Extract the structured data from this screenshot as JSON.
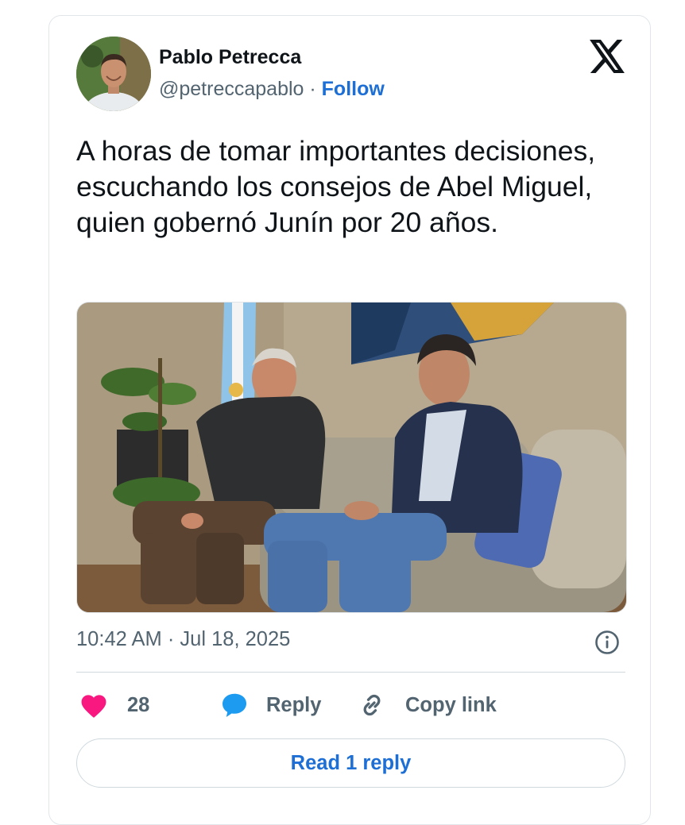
{
  "author": {
    "name": "Pablo Petrecca",
    "handle": "@petreccapablo",
    "separator": " · ",
    "follow_label": "Follow"
  },
  "platform_logo": "x-logo",
  "tweet": {
    "text": "A horas de tomar importantes decisiones, escuchando los consejos de Abel Miguel, quien gobernó Junín por 20 años.",
    "timestamp": "10:42 AM · Jul 18, 2025"
  },
  "actions": {
    "like_count": "28",
    "reply_label": "Reply",
    "copy_label": "Copy link",
    "read_replies_label": "Read 1 reply"
  },
  "icons": {
    "like": "heart-icon",
    "reply": "speech-bubble-icon",
    "copy": "link-icon",
    "info": "info-icon"
  },
  "colors": {
    "accent": "#1d6fd6",
    "like": "#f91880",
    "reply": "#1d9bf0",
    "text": "#0f1419",
    "muted": "#536471"
  }
}
